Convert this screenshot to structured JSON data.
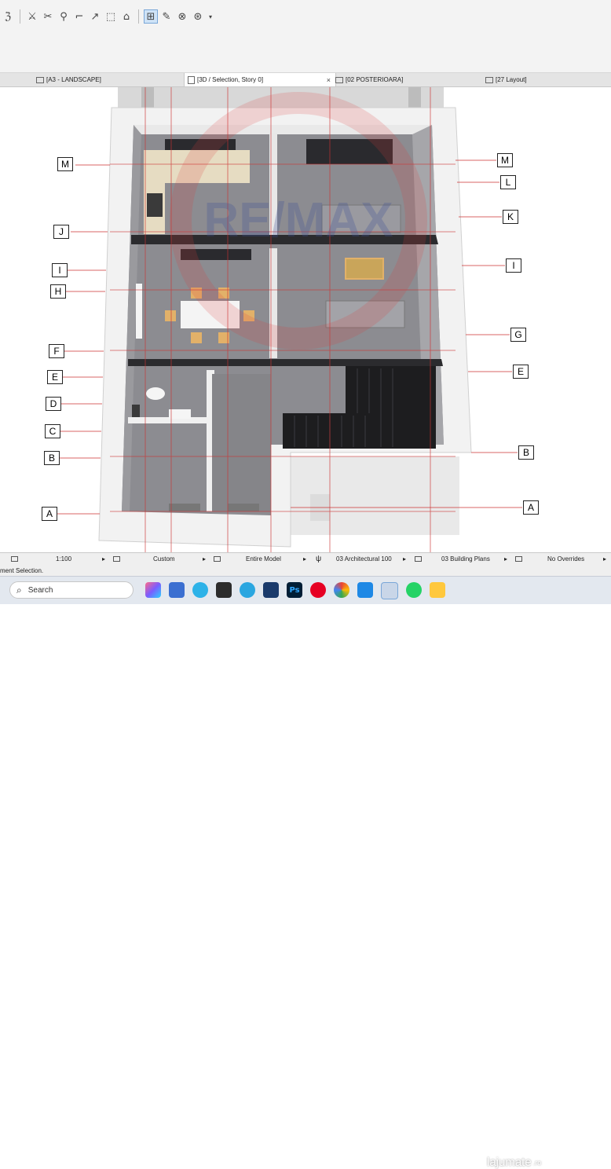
{
  "tabs": [
    {
      "label": "[A3 - LANDSCAPE]"
    },
    {
      "label": "[3D / Selection, Story 0]",
      "close": "×"
    },
    {
      "label": "[02 POSTERIOARA]"
    },
    {
      "label": "[27 Layout]"
    }
  ],
  "toolbar": {
    "icons": [
      "ℨ",
      "⚔",
      "✂",
      "⚲",
      "⌐",
      "↗",
      "⬚",
      "⌂",
      "⊞",
      "✎",
      "⊗",
      "⊛",
      "▾"
    ]
  },
  "plan": {
    "left_labels": [
      "M",
      "J",
      "I",
      "H",
      "F",
      "E",
      "D",
      "C",
      "B",
      "A"
    ],
    "right_labels": [
      "M",
      "L",
      "K",
      "I",
      "G",
      "E",
      "B",
      "A"
    ],
    "watermark_text": "RE/MAX"
  },
  "status": {
    "scale": "1:100",
    "layer": "Custom",
    "model": "Entire Model",
    "pen": "03 Architectural 100",
    "plans": "03 Building Plans",
    "overrides": "No Overrides",
    "arrow": "▸"
  },
  "message": "ment Selection.",
  "taskbar": {
    "search_placeholder": "Search",
    "watermark": "lajumate",
    "watermark_suffix": ".ro"
  },
  "colors": {
    "accent": "#4a7fc1",
    "wall": "#f1f1f1",
    "floor": "#8f8f94",
    "stair": "#1d1d1f",
    "dim_line": "#cc3333"
  }
}
